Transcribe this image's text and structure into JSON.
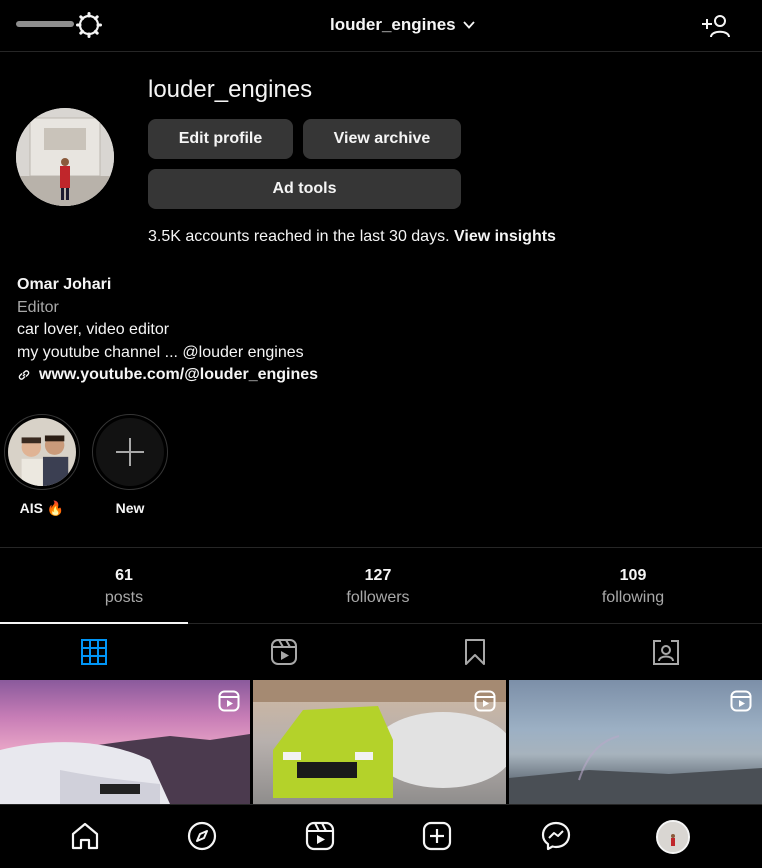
{
  "topbar": {
    "username": "louder_engines"
  },
  "profile": {
    "username": "louder_engines",
    "edit_profile_label": "Edit profile",
    "view_archive_label": "View archive",
    "ad_tools_label": "Ad tools",
    "reach_text": "3.5K accounts reached in the last 30 days.",
    "insights_link": "View insights"
  },
  "bio": {
    "name": "Omar Johari",
    "category": "Editor",
    "line1": "car lover, video editor",
    "line2": "my youtube channel ... @louder engines",
    "link": "www.youtube.com/@louder_engines"
  },
  "highlights": [
    {
      "label": "AIS 🔥"
    },
    {
      "label": "New"
    }
  ],
  "stats": {
    "posts": {
      "value": "61",
      "label": "posts"
    },
    "followers": {
      "value": "127",
      "label": "followers"
    },
    "following": {
      "value": "109",
      "label": "following"
    }
  },
  "colors": {
    "accent": "#0095f6",
    "button_bg": "#363636",
    "muted_text": "#a8a8a8"
  },
  "icons": {
    "topbar": [
      "settings-icon",
      "chevron-down-icon",
      "add-user-icon"
    ],
    "tabs": [
      "grid-icon",
      "reels-icon",
      "bookmark-icon",
      "tagged-icon"
    ],
    "nav": [
      "home-icon",
      "explore-icon",
      "reels-icon",
      "create-icon",
      "messenger-icon",
      "profile-avatar"
    ]
  }
}
